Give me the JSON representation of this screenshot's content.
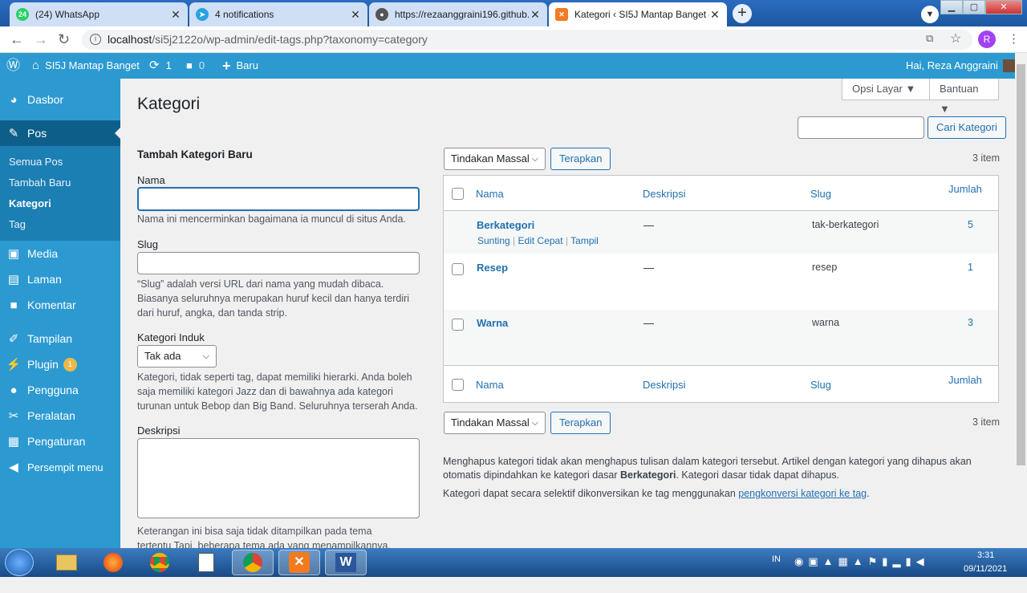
{
  "browser": {
    "tabs": [
      {
        "title": "(24) WhatsApp",
        "badge": "24"
      },
      {
        "title": "4 notifications"
      },
      {
        "title": "https://rezaanggraini196.github.i"
      },
      {
        "title": "Kategori ‹ SI5J Mantap Banget —"
      }
    ],
    "url_host": "localhost",
    "url_path": "/si5j2122o/wp-admin/edit-tags.php?taxonomy=category",
    "profile_initial": "R"
  },
  "adminbar": {
    "site_name": "SI5J Mantap Banget",
    "updates": "1",
    "comments": "0",
    "new_label": "Baru",
    "greeting": "Hai, Reza Anggraini"
  },
  "sidebar": {
    "dashboard": "Dasbor",
    "posts": "Pos",
    "sub_all": "Semua Pos",
    "sub_add": "Tambah Baru",
    "sub_cat": "Kategori",
    "sub_tag": "Tag",
    "media": "Media",
    "pages": "Laman",
    "comments": "Komentar",
    "appearance": "Tampilan",
    "plugins": "Plugin",
    "plugins_badge": "1",
    "users": "Pengguna",
    "tools": "Peralatan",
    "settings": "Pengaturan",
    "collapse": "Persempit menu"
  },
  "page": {
    "screen_options": "Opsi Layar ▼",
    "help": "Bantuan ▼",
    "title": "Kategori",
    "search_button": "Cari Kategori",
    "search_value": ""
  },
  "form": {
    "heading": "Tambah Kategori Baru",
    "name_label": "Nama",
    "name_value": "",
    "name_help": "Nama ini mencerminkan bagaimana ia muncul di situs Anda.",
    "slug_label": "Slug",
    "slug_value": "",
    "slug_help": "“Slug” adalah versi URL dari nama yang mudah dibaca. Biasanya seluruhnya merupakan huruf kecil dan hanya terdiri dari huruf, angka, dan tanda strip.",
    "parent_label": "Kategori Induk",
    "parent_value": "Tak ada",
    "parent_help": "Kategori, tidak seperti tag, dapat memiliki hierarki. Anda boleh saja memiliki kategori Jazz dan di bawahnya ada kategori turunan untuk Bebop dan Big Band. Seluruhnya terserah Anda.",
    "desc_label": "Deskripsi",
    "desc_help": "Keterangan ini bisa saja tidak ditampilkan pada tema tertentu Tapi, beberapa tema ada yang menampilkannya."
  },
  "table": {
    "bulk_action": "Tindakan Massal",
    "apply": "Terapkan",
    "count": "3 item",
    "col_name": "Nama",
    "col_desc": "Deskripsi",
    "col_slug": "Slug",
    "col_count": "Jumlah",
    "rows": [
      {
        "name": "Berkategori",
        "desc": "—",
        "slug": "tak-berkategori",
        "count": "5"
      },
      {
        "name": "Resep",
        "desc": "—",
        "slug": "resep",
        "count": "1"
      },
      {
        "name": "Warna",
        "desc": "—",
        "slug": "warna",
        "count": "3"
      }
    ],
    "row_actions": {
      "edit": "Sunting",
      "quick": "Edit Cepat",
      "view": "Tampil",
      "sep": "|"
    }
  },
  "notes": {
    "p1_a": "Menghapus kategori tidak akan menghapus tulisan dalam kategori tersebut. Artikel dengan kategori yang dihapus akan otomatis dipindahkan ke kategori dasar ",
    "p1_b": "Berkategori",
    "p1_c": ". Kategori dasar tidak dapat dihapus.",
    "p2_a": "Kategori dapat secara selektif dikonversikan ke tag menggunakan ",
    "p2_link": "pengkonversi kategori ke tag",
    "p2_b": "."
  },
  "taskbar": {
    "lang": "IN",
    "time": "3:31",
    "date": "09/11/2021"
  }
}
